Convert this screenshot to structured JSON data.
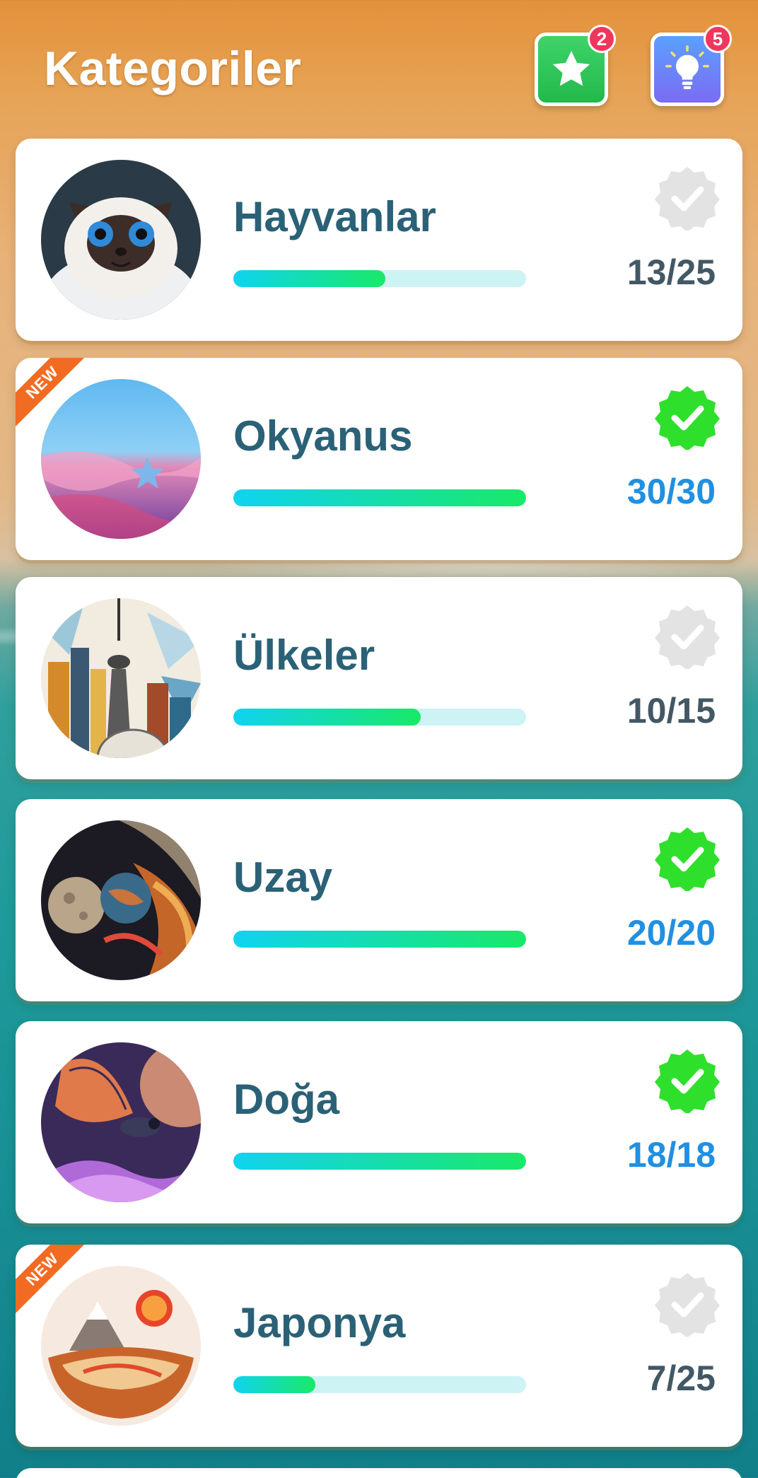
{
  "header": {
    "title": "Kategoriler",
    "star_badge": "2",
    "hint_badge": "5"
  },
  "categories": [
    {
      "name": "Hayvanlar",
      "count": "13/25",
      "progress": 0.52,
      "completed": false,
      "is_new": false,
      "thumb": "cat"
    },
    {
      "name": "Okyanus",
      "count": "30/30",
      "progress": 1.0,
      "completed": true,
      "is_new": true,
      "thumb": "ocean"
    },
    {
      "name": "Ülkeler",
      "count": "10/15",
      "progress": 0.667,
      "completed": false,
      "is_new": false,
      "thumb": "city"
    },
    {
      "name": "Uzay",
      "count": "20/20",
      "progress": 1.0,
      "completed": true,
      "is_new": false,
      "thumb": "space"
    },
    {
      "name": "Doğa",
      "count": "18/18",
      "progress": 1.0,
      "completed": true,
      "is_new": false,
      "thumb": "butterfly"
    },
    {
      "name": "Japonya",
      "count": "7/25",
      "progress": 0.28,
      "completed": false,
      "is_new": true,
      "thumb": "japan"
    }
  ],
  "new_label": "NEW",
  "colors": {
    "title_text": "#2b6177",
    "count_incomplete": "#435865",
    "count_complete": "#2190e0",
    "check_complete": "#2ee02b",
    "check_incomplete": "#e3e3e3",
    "new_ribbon": "#f26b22"
  }
}
